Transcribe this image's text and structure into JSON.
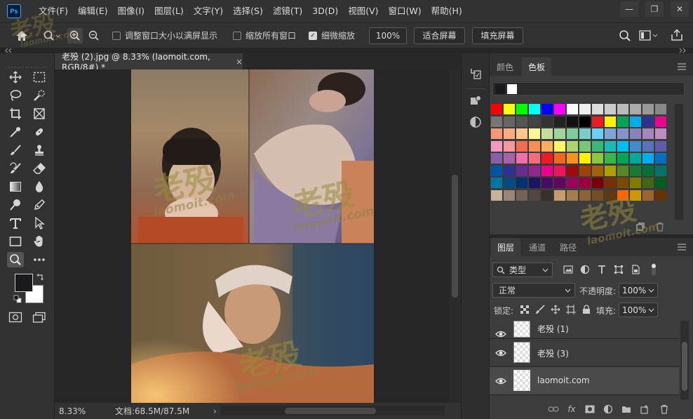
{
  "menu": {
    "logo": "Ps",
    "items": [
      "文件(F)",
      "编辑(E)",
      "图像(I)",
      "图层(L)",
      "文字(Y)",
      "选择(S)",
      "滤镜(T)",
      "3D(D)",
      "视图(V)",
      "窗口(W)",
      "帮助(H)"
    ]
  },
  "window_controls": {
    "minimize": "—",
    "restore": "❐",
    "close": "✕"
  },
  "options": {
    "resize_windows": "调整窗口大小以满屏显示",
    "zoom_all": "缩放所有窗口",
    "scrubby_zoom": "细微缩放",
    "zoom_value": "100%",
    "fit_screen": "适合屏幕",
    "fill_screen": "填充屏幕"
  },
  "document": {
    "tab_title": "老殁 (2).jpg @ 8.33% (laomoit.com, RGB/8#) *",
    "close": "×"
  },
  "status": {
    "zoom": "8.33%",
    "doc_size": "文档:68.5M/87.5M",
    "arrow": "›"
  },
  "swatches_panel": {
    "tabs": [
      "颜色",
      "色板"
    ],
    "active_tab": "色板"
  },
  "layers_panel": {
    "tabs": [
      "图层",
      "通道",
      "路径"
    ],
    "active_tab": "图层",
    "filter_kind": "类型",
    "blend_mode": "正常",
    "opacity_label": "不透明度:",
    "opacity_value": "100%",
    "lock_label": "锁定:",
    "fill_label": "填充:",
    "fill_value": "100%",
    "layers": [
      {
        "name": "老殁 (1)",
        "visible": true,
        "selected": false
      },
      {
        "name": "老殁 (3)",
        "visible": true,
        "selected": false
      },
      {
        "name": "laomoit.com",
        "visible": true,
        "selected": true
      }
    ]
  },
  "watermarks": {
    "main": "老殁",
    "sub": "laomoit.com"
  },
  "colors": {
    "accent": "#31a8ff",
    "panel": "#323232",
    "canvas_bg": "#262626",
    "selected_layer": "#4a4a4a"
  }
}
